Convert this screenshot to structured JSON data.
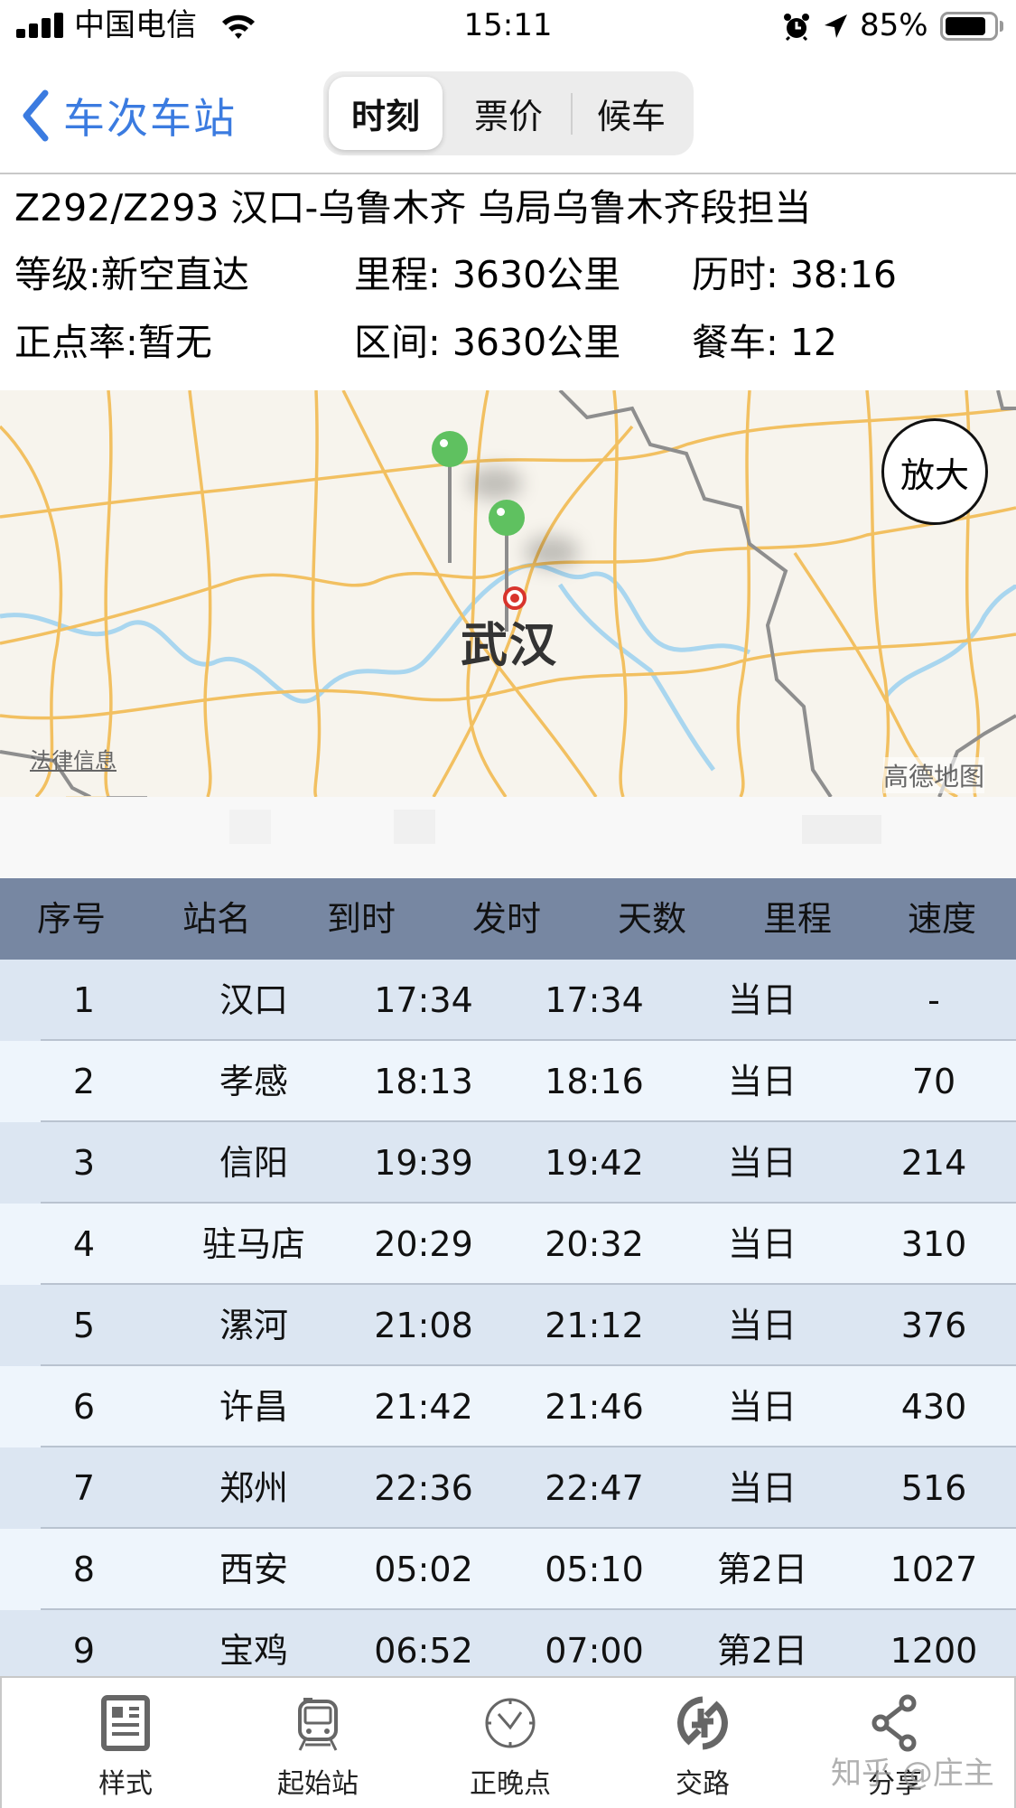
{
  "status_bar": {
    "carrier": "中国电信",
    "time": "15:11",
    "battery_percent": "85%",
    "battery_level": 0.85,
    "icons": [
      "signal-icon",
      "wifi-icon",
      "alarm-icon",
      "location-icon",
      "battery-icon"
    ]
  },
  "nav": {
    "back_label": "车次车站",
    "tabs": [
      {
        "label": "时刻",
        "active": true
      },
      {
        "label": "票价",
        "active": false
      },
      {
        "label": "候车",
        "active": false
      }
    ]
  },
  "train": {
    "title": "Z292/Z293   汉口-乌鲁木齐 乌局乌鲁木齐段担当",
    "grade": "等级:新空直达",
    "mileage": "里程: 3630公里",
    "duration": "历时: 38:16",
    "punctuality": "正点率:暂无",
    "section": "区间: 3630公里",
    "dining_car": "餐车: 12"
  },
  "map": {
    "city_label": "武汉",
    "zoom_button": "放大",
    "legal_link": "法律信息",
    "brand": "高德地图"
  },
  "table": {
    "headers": [
      "序号",
      "站名",
      "到时",
      "发时",
      "天数",
      "里程",
      "速度"
    ],
    "rows": [
      [
        "1",
        "汉口",
        "17:34",
        "17:34",
        "当日",
        "-"
      ],
      [
        "2",
        "孝感",
        "18:13",
        "18:16",
        "当日",
        "70"
      ],
      [
        "3",
        "信阳",
        "19:39",
        "19:42",
        "当日",
        "214"
      ],
      [
        "4",
        "驻马店",
        "20:29",
        "20:32",
        "当日",
        "310"
      ],
      [
        "5",
        "漯河",
        "21:08",
        "21:12",
        "当日",
        "376"
      ],
      [
        "6",
        "许昌",
        "21:42",
        "21:46",
        "当日",
        "430"
      ],
      [
        "7",
        "郑州",
        "22:36",
        "22:47",
        "当日",
        "516"
      ],
      [
        "8",
        "西安",
        "05:02",
        "05:10",
        "第2日",
        "1027"
      ],
      [
        "9",
        "宝鸡",
        "06:52",
        "07:00",
        "第2日",
        "1200"
      ]
    ]
  },
  "tab_bar": {
    "items": [
      {
        "label": "样式",
        "icon": "style-icon"
      },
      {
        "label": "起始站",
        "icon": "train-icon"
      },
      {
        "label": "正晚点",
        "icon": "clock-icon"
      },
      {
        "label": "交路",
        "icon": "swap-icon"
      },
      {
        "label": "分享",
        "icon": "share-icon"
      }
    ]
  },
  "watermark": "知乎 @庄主",
  "colors": {
    "accent": "#3b7be0",
    "table_header": "#7787a2",
    "row_odd": "#dce6f2",
    "row_even": "#eef5fc",
    "pin": "#5fc160",
    "target": "#d8342c"
  }
}
